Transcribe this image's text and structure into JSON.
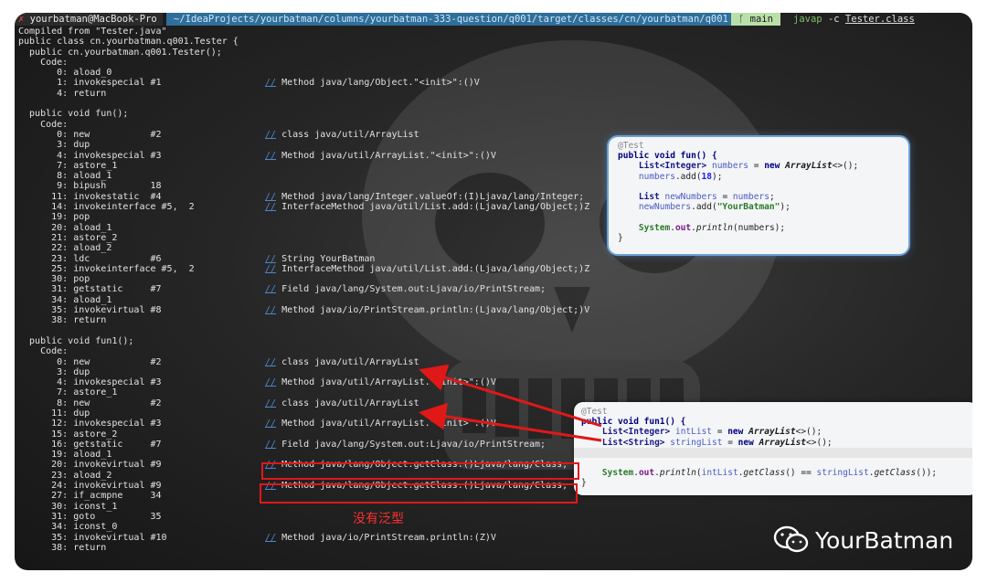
{
  "topbar": {
    "user_host": "yourbatman@MacBook-Pro",
    "path": "~/IdeaProjects/yourbatman/columns/yourbatman-333-question/q001/target/classes/cn/yourbatman/q001",
    "branch": "main",
    "cmd_prog": "javap",
    "cmd_flag": "-c",
    "cmd_arg": "Tester.class"
  },
  "terminal": {
    "lines": [
      {
        "code": "Compiled from \"Tester.java\"",
        "comment": ""
      },
      {
        "code": "public class cn.yourbatman.q001.Tester {",
        "comment": ""
      },
      {
        "code": "  public cn.yourbatman.q001.Tester();",
        "comment": ""
      },
      {
        "code": "    Code:",
        "comment": ""
      },
      {
        "code": "       0: aload_0",
        "comment": ""
      },
      {
        "code": "       1: invokespecial #1",
        "comment": "Method java/lang/Object.\"<init>\":()V"
      },
      {
        "code": "       4: return",
        "comment": ""
      },
      {
        "code": "",
        "comment": ""
      },
      {
        "code": "  public void fun();",
        "comment": ""
      },
      {
        "code": "    Code:",
        "comment": ""
      },
      {
        "code": "       0: new           #2",
        "comment": "class java/util/ArrayList"
      },
      {
        "code": "       3: dup",
        "comment": ""
      },
      {
        "code": "       4: invokespecial #3",
        "comment": "Method java/util/ArrayList.\"<init>\":()V"
      },
      {
        "code": "       7: astore_1",
        "comment": ""
      },
      {
        "code": "       8: aload_1",
        "comment": ""
      },
      {
        "code": "       9: bipush        18",
        "comment": ""
      },
      {
        "code": "      11: invokestatic  #4",
        "comment": "Method java/lang/Integer.valueOf:(I)Ljava/lang/Integer;"
      },
      {
        "code": "      14: invokeinterface #5,  2",
        "comment": "InterfaceMethod java/util/List.add:(Ljava/lang/Object;)Z"
      },
      {
        "code": "      19: pop",
        "comment": ""
      },
      {
        "code": "      20: aload_1",
        "comment": ""
      },
      {
        "code": "      21: astore_2",
        "comment": ""
      },
      {
        "code": "      22: aload_2",
        "comment": ""
      },
      {
        "code": "      23: ldc           #6",
        "comment": "String YourBatman"
      },
      {
        "code": "      25: invokeinterface #5,  2",
        "comment": "InterfaceMethod java/util/List.add:(Ljava/lang/Object;)Z"
      },
      {
        "code": "      30: pop",
        "comment": ""
      },
      {
        "code": "      31: getstatic     #7",
        "comment": "Field java/lang/System.out:Ljava/io/PrintStream;"
      },
      {
        "code": "      34: aload_1",
        "comment": ""
      },
      {
        "code": "      35: invokevirtual #8",
        "comment": "Method java/io/PrintStream.println:(Ljava/lang/Object;)V"
      },
      {
        "code": "      38: return",
        "comment": ""
      },
      {
        "code": "",
        "comment": ""
      },
      {
        "code": "  public void fun1();",
        "comment": ""
      },
      {
        "code": "    Code:",
        "comment": ""
      },
      {
        "code": "       0: new           #2",
        "comment": "class java/util/ArrayList"
      },
      {
        "code": "       3: dup",
        "comment": ""
      },
      {
        "code": "       4: invokespecial #3",
        "comment": "Method java/util/ArrayList.\"<init>\":()V"
      },
      {
        "code": "       7: astore_1",
        "comment": ""
      },
      {
        "code": "       8: new           #2",
        "comment": "class java/util/ArrayList"
      },
      {
        "code": "      11: dup",
        "comment": ""
      },
      {
        "code": "      12: invokespecial #3",
        "comment": "Method java/util/ArrayList.\"<init>\":()V"
      },
      {
        "code": "      15: astore_2",
        "comment": ""
      },
      {
        "code": "      16: getstatic     #7",
        "comment": "Field java/lang/System.out:Ljava/io/PrintStream;"
      },
      {
        "code": "      19: aload_1",
        "comment": ""
      },
      {
        "code": "      20: invokevirtual #9",
        "comment": "Method java/lang/Object.getClass:()Ljava/lang/Class;"
      },
      {
        "code": "      23: aload_2",
        "comment": ""
      },
      {
        "code": "      24: invokevirtual #9",
        "comment": "Method java/lang/Object.getClass:()Ljava/lang/Class;"
      },
      {
        "code": "      27: if_acmpne     34",
        "comment": ""
      },
      {
        "code": "      30: iconst_1",
        "comment": ""
      },
      {
        "code": "      31: goto          35",
        "comment": ""
      },
      {
        "code": "      34: iconst_0",
        "comment": ""
      },
      {
        "code": "      35: invokevirtual #10",
        "comment": "Method java/io/PrintStream.println:(Z)V"
      },
      {
        "code": "      38: return",
        "comment": ""
      }
    ]
  },
  "card1": {
    "annotation": "@Test",
    "signature": "public void fun() {",
    "l1_type": "List<Integer>",
    "l1_var": "numbers",
    "l1_eq": " = ",
    "l1_new": "new",
    "l1_cls": "ArrayList",
    "l1_end": "<>();",
    "l2_var": "numbers",
    "l2_call": ".add(",
    "l2_num": "18",
    "l2_end": ");",
    "l3_type": "List",
    "l3_var": "newNumbers",
    "l3_eq": " = ",
    "l3_rhs": "numbers",
    "l3_end": ";",
    "l4_var": "newNumbers",
    "l4_call": ".add(",
    "l4_str": "\"YourBatman\"",
    "l4_end": ");",
    "l5_sys": "System",
    "l5_out": "out",
    "l5_call": "println",
    "l5_args": "(numbers);",
    "close": "}"
  },
  "card2": {
    "annotation": "@Test",
    "signature": "public void fun1() {",
    "l1_type": "List<Integer>",
    "l1_var": "intList",
    "l1_eq": " = ",
    "l1_new": "new",
    "l1_cls": "ArrayList",
    "l1_end": "<>();",
    "l2_type": "List<String>",
    "l2_var": "stringList",
    "l2_eq": " = ",
    "l2_new": "new",
    "l2_cls": "ArrayList",
    "l2_end": "<>();",
    "l3_sys": "System",
    "l3_out": "out",
    "l3_call": "println",
    "l3_a": "intList",
    "l3_gc": "getClass",
    "l3_mid": "() == ",
    "l3_b": "stringList",
    "l3_end": "());",
    "close": "}"
  },
  "annotation_note": "没有泛型",
  "brand": {
    "name": "YourBatman",
    "icon": "wechat-icon"
  },
  "colors": {
    "accent_red": "#e01818",
    "path_blue": "#2f6f9a",
    "branch_green": "#b8e0a8",
    "comment_blue": "#4d86d0"
  }
}
